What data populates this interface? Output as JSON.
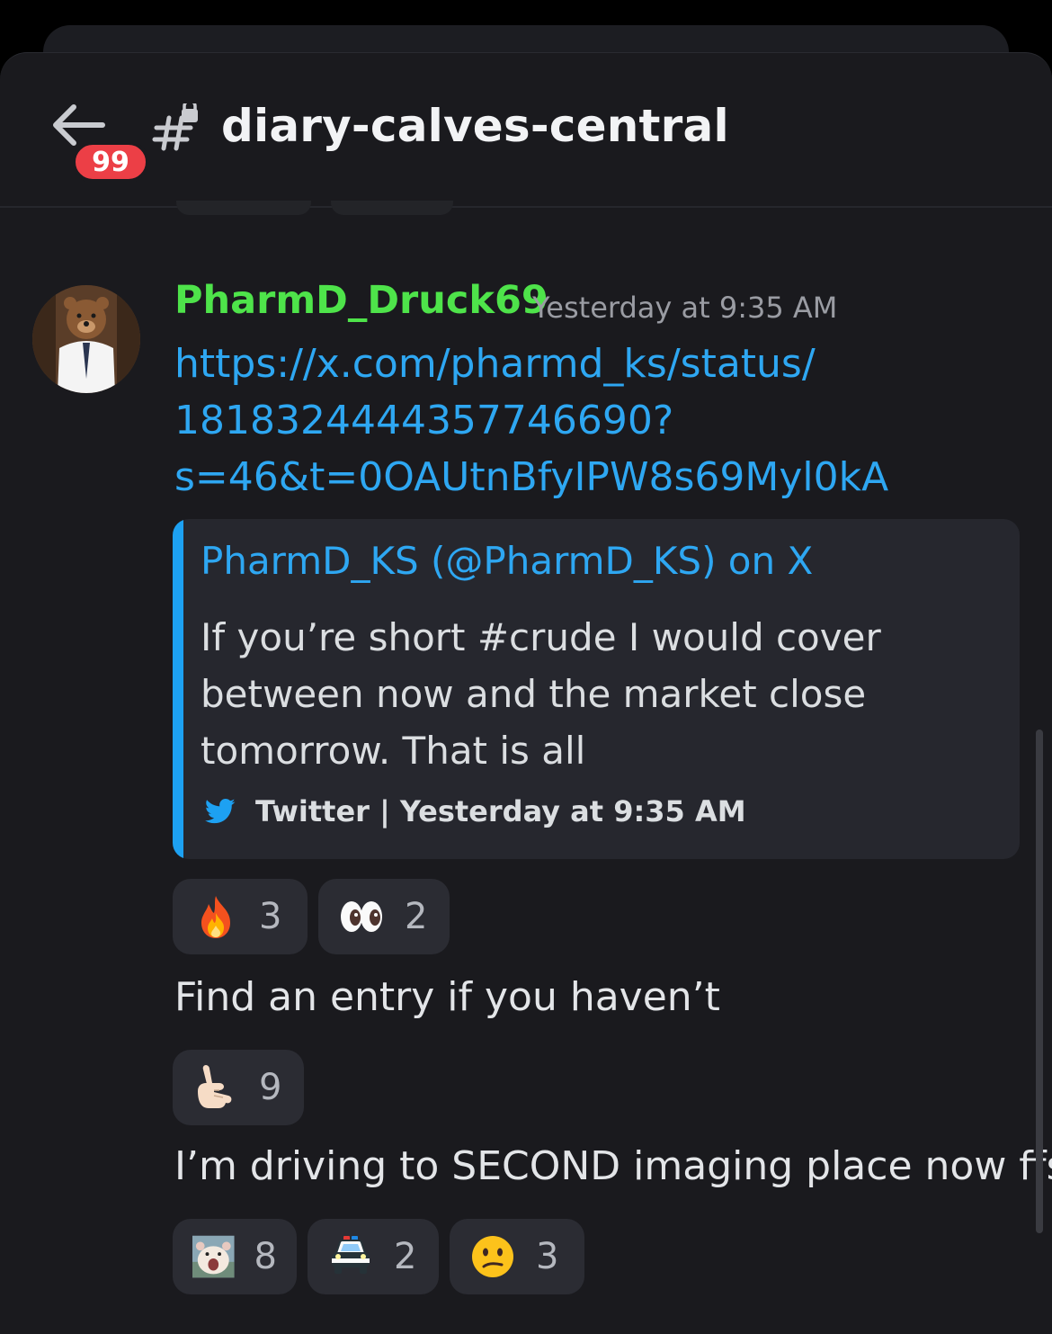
{
  "header": {
    "back_label": "Back",
    "unread_badge": "99",
    "channel_name": "diary-calves-central"
  },
  "message": {
    "author": "PharmD_Druck69",
    "author_color": "#4ee34a",
    "timestamp": "Yesterday at 9:35 AM",
    "link_lines": [
      "https://x.com/pharmd_ks/status/",
      "1818324444357746690?",
      "s=46&t=0OAUtnBfyIPW8s69Myl0kA"
    ],
    "embed": {
      "accent_color": "#1da1f2",
      "title": "PharmD_KS (@PharmD_KS) on X",
      "description_lines": [
        "If you’re short #crude I would cover",
        "between now and the market close",
        "tomorrow. That is all"
      ],
      "provider_icon": "twitter-bird-icon",
      "footer": "Twitter | Yesterday at 9:35 AM"
    },
    "reactions": [
      {
        "emoji": "fire",
        "count": "3"
      },
      {
        "emoji": "eyes",
        "count": "2"
      }
    ]
  },
  "followups": [
    {
      "text": "Find an entry if you haven’t",
      "reactions": [
        {
          "emoji": "call-me-hand",
          "count": "9"
        }
      ]
    },
    {
      "text": "I’m driving to SECOND imaging place now ffs",
      "reactions": [
        {
          "emoji": "custom-screaming-hamster",
          "count": "8"
        },
        {
          "emoji": "police-car",
          "count": "2"
        },
        {
          "emoji": "confused-face",
          "count": "3"
        }
      ]
    }
  ]
}
